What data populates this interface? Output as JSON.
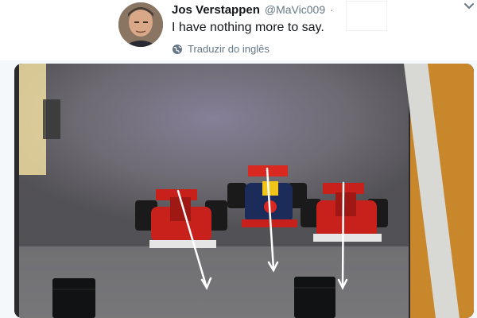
{
  "tweet": {
    "display_name": "Jos Verstappen",
    "handle": "@MaVic009",
    "separator": "·",
    "text": "I have nothing more to say.",
    "translate_label": "Traduzir do inglês"
  },
  "icons": {
    "avatar": "avatar",
    "translate": "globe-icon",
    "more": "chevron-down-icon"
  },
  "colors": {
    "name": "#14171a",
    "muted": "#657786",
    "header_bg": "#ffffff",
    "page_bg": "#f5f8fa",
    "car_red": "#c8211b",
    "car_blue": "#1b2c5a",
    "arrow": "#ffffff"
  }
}
